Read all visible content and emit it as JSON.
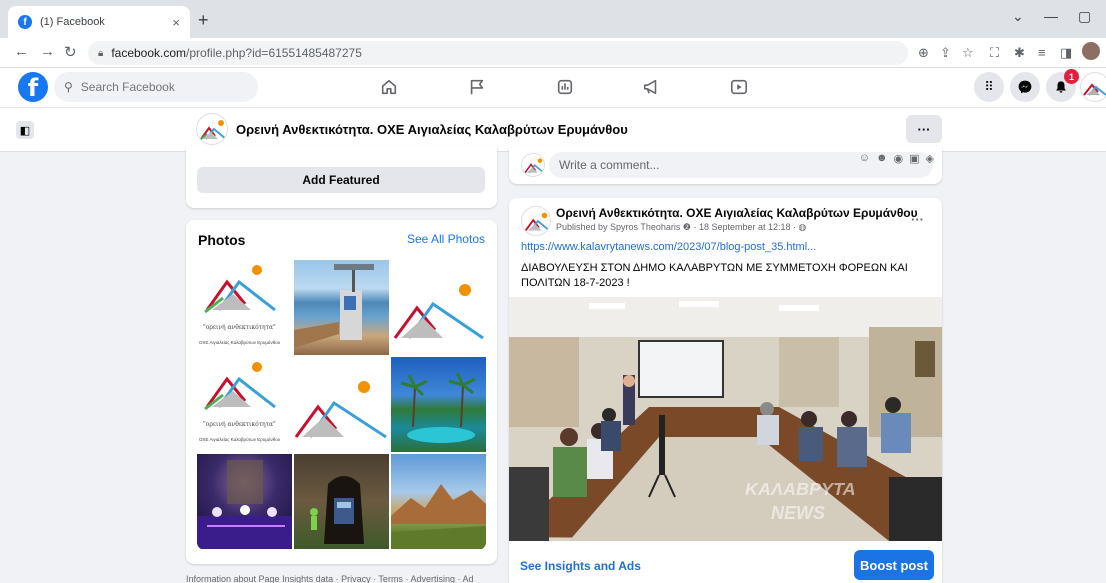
{
  "browser": {
    "tab_title": "(1) Facebook",
    "tab_close": "×",
    "new_tab": "+",
    "url_host": "facebook.com",
    "url_path": "/profile.php?id=61551485487275"
  },
  "fb": {
    "search_placeholder": "Search Facebook",
    "notification_count": "1"
  },
  "page": {
    "name": "Ορεινή Ανθεκτικότητα. ΟΧΕ Αιγιαλείας Καλαβρύτων Ερυμάνθου",
    "more": "···"
  },
  "featured": {
    "add_label": "Add Featured"
  },
  "photos": {
    "title": "Photos",
    "see_all": "See All Photos",
    "logo_caption_1": "\"ορεινή ανθεκτικότητα\"",
    "logo_caption_2": "ΟΧΕ Αιγιαλείας Καλαβρύτων Ερυμάνθου"
  },
  "footer": {
    "info": "Information about Page Insights data · Privacy · Terms · Advertising · Ad"
  },
  "comment": {
    "placeholder": "Write a comment..."
  },
  "post": {
    "author": "Ορεινή Ανθεκτικότητα. ΟΧΕ Αιγιαλείας Καλαβρύτων Ερυμάνθου",
    "meta": "Published by Spyros Theoharis ❷ · 18 September at 12:18 · ◍",
    "more": "···",
    "link": "https://www.kalavrytanews.com/2023/07/blog-post_35.html...",
    "text": "ΔΙΑΒΟΥΛΕΥΣΗ ΣΤΟΝ ΔΗΜΟ ΚΑΛΑΒΡΥΤΩΝ ΜΕ ΣΥΜΜΕΤΟΧΗ ΦΟΡΕΩΝ ΚΑΙ ΠΟΛΙΤΩΝ 18-7-2023 !",
    "watermark_1": "ΚΑΛΑΒΡΥΤΑ",
    "watermark_2": "NEWS",
    "insights_label": "See Insights and Ads",
    "boost_label": "Boost post"
  },
  "colors": {
    "fb_blue": "#1877f2",
    "link_blue": "#216fdb",
    "badge_red": "#e41e3f"
  }
}
